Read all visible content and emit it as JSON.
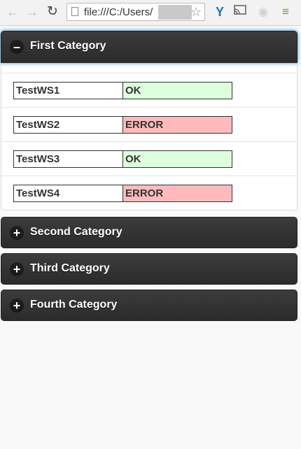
{
  "browser": {
    "url_text": "file:///C:/Users/",
    "icons": {
      "back": "arrow-left-icon",
      "forward": "arrow-right-icon",
      "reload": "reload-icon",
      "bookmark": "star-icon",
      "extension": "y-extension-icon",
      "cast": "cast-icon",
      "extension2": "grey-extension-icon",
      "menu": "hamburger-menu-icon"
    }
  },
  "colors": {
    "ok": "#ddffdd",
    "error": "#ffbbbb",
    "header": "#333333"
  },
  "categories": [
    {
      "label": "First Category",
      "expanded": true,
      "icon": "minus-icon",
      "services": [
        {
          "name": "TestWS1",
          "status": "OK"
        },
        {
          "name": "TestWS2",
          "status": "ERROR"
        },
        {
          "name": "TestWS3",
          "status": "OK"
        },
        {
          "name": "TestWS4",
          "status": "ERROR"
        }
      ]
    },
    {
      "label": "Second Category",
      "expanded": false,
      "icon": "plus-icon"
    },
    {
      "label": "Third Category",
      "expanded": false,
      "icon": "plus-icon"
    },
    {
      "label": "Fourth Category",
      "expanded": false,
      "icon": "plus-icon"
    }
  ]
}
